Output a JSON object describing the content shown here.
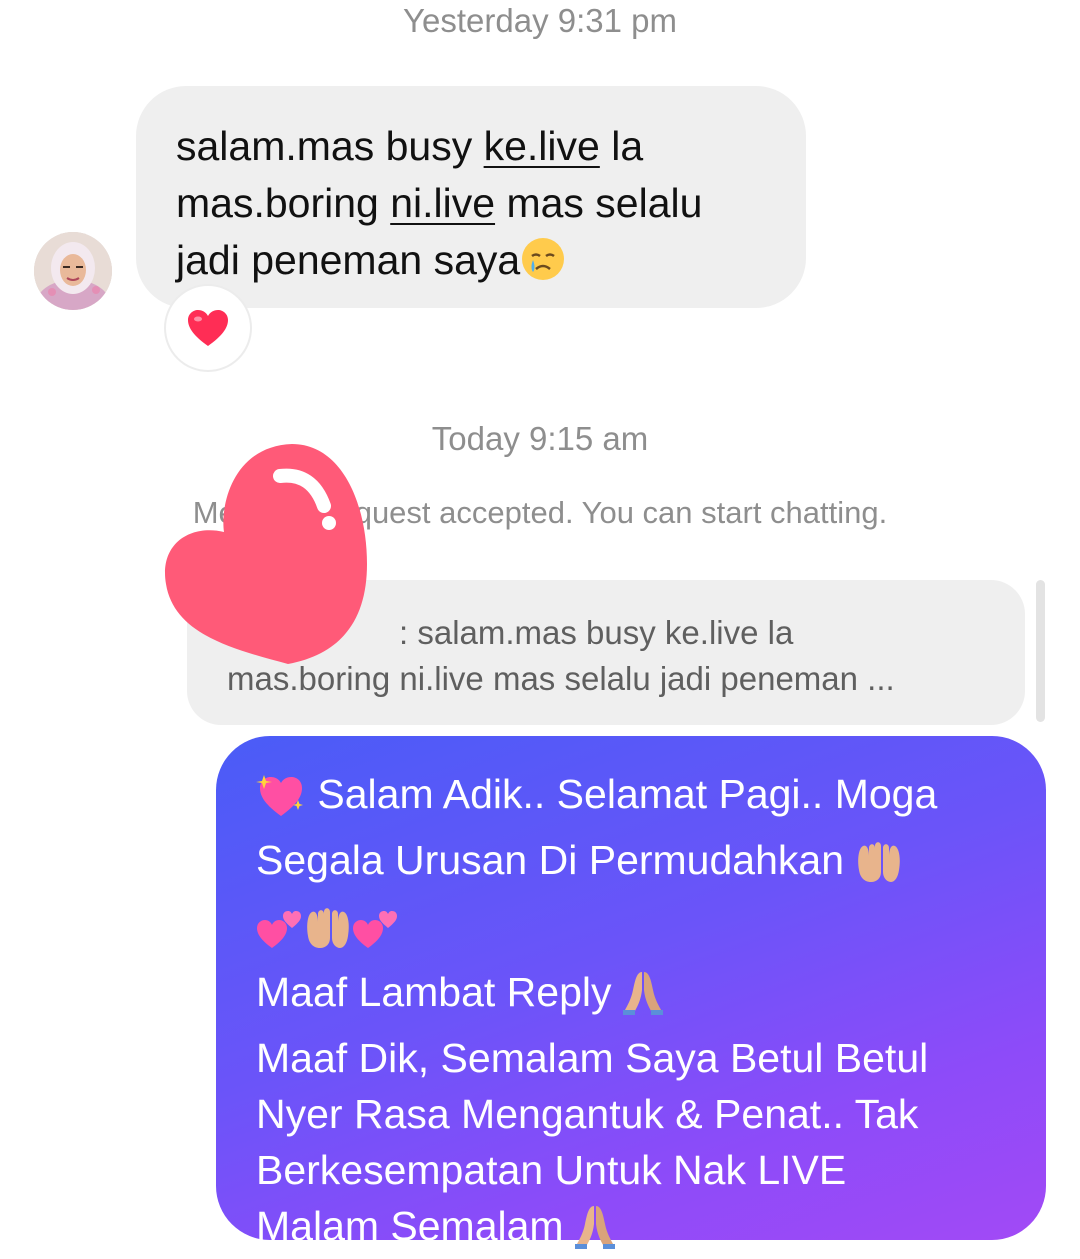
{
  "thread": {
    "timestamp_yesterday": "Yesterday 9:31 pm",
    "timestamp_today": "Today 9:15 am",
    "system_message": "Message request accepted. You can start chatting."
  },
  "incoming_message": {
    "line1_a": "salam.mas busy ",
    "line1_link": "ke.live",
    "line1_b": " la",
    "line2_a": "mas.boring ",
    "line2_link": "ni.live",
    "line2_b": " mas selalu",
    "line3": "jadi peneman saya",
    "reaction": "heart",
    "avatar": "user-avatar"
  },
  "reply_preview": {
    "line1": ": salam.mas busy ke.live la",
    "line2": "mas.boring ni.live mas selalu jadi peneman ..."
  },
  "outgoing_message": {
    "line1": "Salam Adik.. Selamat Pagi.. Moga",
    "line2": "Segala Urusan Di Permudahkan",
    "line4": "Maaf Lambat Reply",
    "line5": "Maaf Dik, Semalam Saya Betul Betul",
    "line6": "Nyer Rasa Mengantuk & Penat.. Tak",
    "line7": "Berkesempatan Untuk Nak LIVE",
    "line8": "Malam Semalam"
  },
  "colors": {
    "incoming_bubble": "#efefef",
    "outgoing_gradient_start": "#4a5cf7",
    "outgoing_gradient_end": "#a24af5",
    "sticker_heart": "#ff5a78",
    "timestamp_text": "#8e8e8e"
  }
}
